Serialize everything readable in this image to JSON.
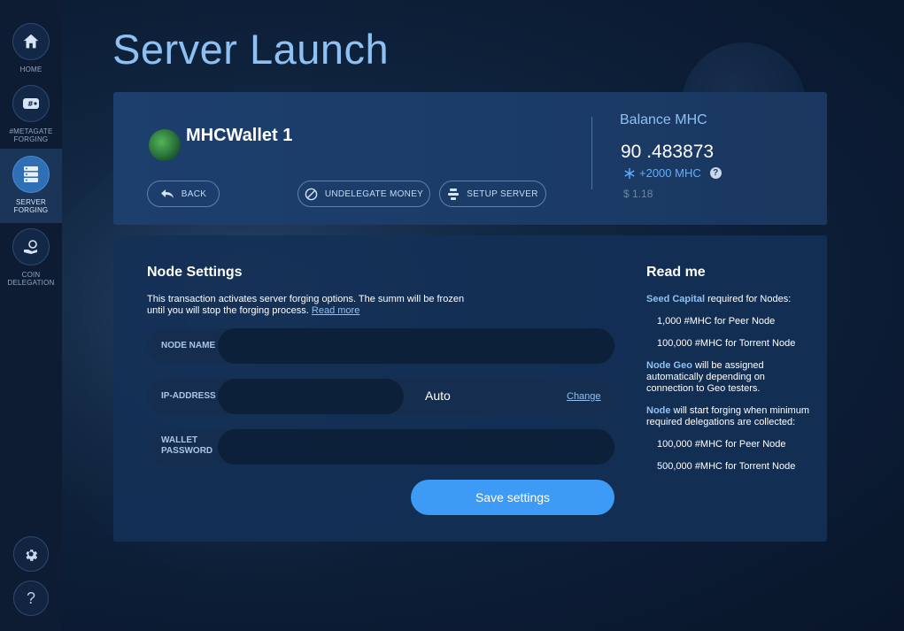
{
  "sidebar": {
    "items": [
      {
        "label": "HOME",
        "icon": "home-icon"
      },
      {
        "label": "#METAGATE FORGING",
        "icon": "wallet-icon"
      },
      {
        "label": "SERVER FORGING",
        "icon": "server-icon",
        "active": true
      },
      {
        "label": "COIN DELEGATION",
        "icon": "hand-coin-icon"
      }
    ],
    "settings_icon": "gear-icon",
    "help_label": "?"
  },
  "page": {
    "title": "Server Launch"
  },
  "wallet": {
    "name": "MHCWallet 1",
    "back_label": "BACK",
    "undelegate_label": "UNDELEGATE MONEY",
    "setup_label": "SETUP SERVER"
  },
  "balance": {
    "title": "Balance MHC",
    "value": "90 .483873",
    "bonus": "+2000 MHC",
    "help": "?",
    "usd": "$ 1.18"
  },
  "node_settings": {
    "title": "Node Settings",
    "desc": "This transaction activates server forging options. The summ will be frozen until you will stop the forging process.",
    "read_more": "Read more",
    "node_name_label": "NODE NAME",
    "node_name_value": "",
    "ip_label": "IP-ADDRESS",
    "ip_value": "",
    "ip_auto": "Auto",
    "ip_change": "Change",
    "password_label_1": "WALLET",
    "password_label_2": "PASSWORD",
    "password_value": "",
    "save_label": "Save settings"
  },
  "readme": {
    "title": "Read me",
    "seed_hl": "Seed Capital",
    "seed_text": " required for Nodes:",
    "seed_peer": "1,000 #MHC for Peer Node",
    "seed_torrent": "100,000 #MHC for Torrent Node",
    "geo_hl": "Node Geo",
    "geo_text": " will be assigned automatically depending on connection to Geo testers.",
    "node_hl": "Node",
    "node_text": " will start forging when minimum required delegations are collected:",
    "deleg_peer": "100,000 #MHC for Peer Node",
    "deleg_torrent": "500,000 #MHC for Torrent Node"
  },
  "colors": {
    "accent": "#3d9bf5",
    "title": "#8ec1f3",
    "card": "#1d3f6d"
  }
}
